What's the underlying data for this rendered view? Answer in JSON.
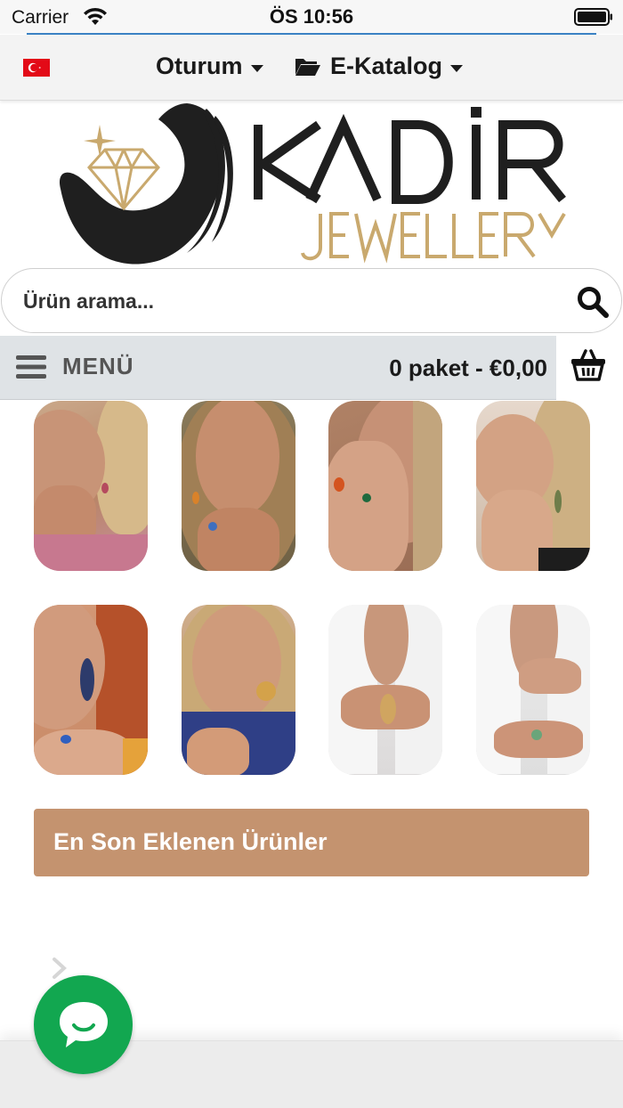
{
  "status_bar": {
    "carrier": "Carrier",
    "time": "ÖS 10:56"
  },
  "top_bar": {
    "login_label": "Oturum",
    "catalog_label": "E-Katalog"
  },
  "logo": {
    "brand": "KADİR",
    "sub": "JEWELLERY"
  },
  "search": {
    "placeholder": "Ürün arama..."
  },
  "menu_bar": {
    "menu_label": "MENÜ",
    "cart_summary": "0 paket - €0,00"
  },
  "section": {
    "title": "En Son Eklenen Ürünler"
  },
  "colors": {
    "accent": "#c4936f",
    "chat": "#12a750",
    "logo_gold": "#c9a96e",
    "logo_dark": "#1f1f1f"
  },
  "icons": [
    "wifi-icon",
    "battery-icon",
    "turkey-flag-icon",
    "folder-icon",
    "search-icon",
    "hamburger-icon",
    "basket-icon",
    "chevron-right-icon",
    "chat-icon"
  ]
}
